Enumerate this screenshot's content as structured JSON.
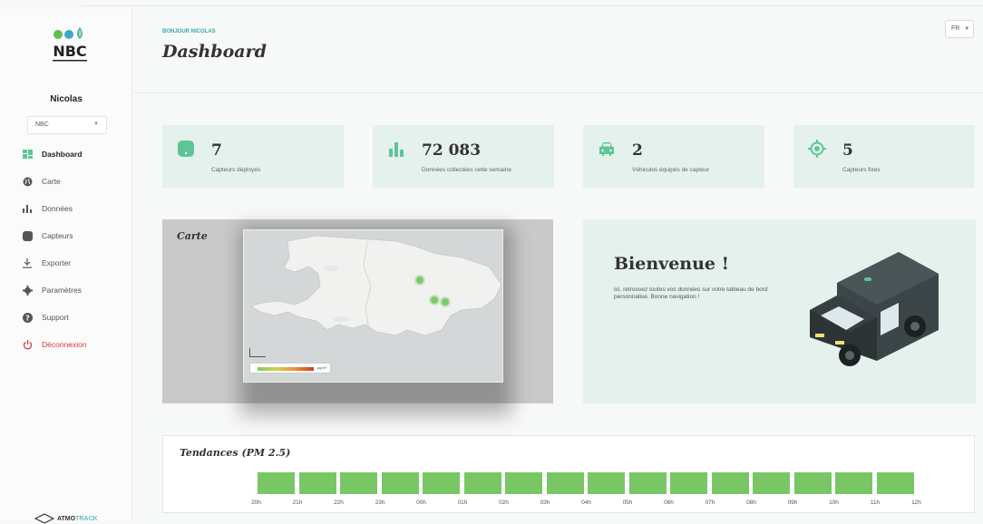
{
  "sidebar": {
    "user_name": "Nicolas",
    "org_select": "NBC",
    "logo_text": "NBC",
    "items": [
      {
        "label": "Dashboard",
        "icon": "dashboard-icon"
      },
      {
        "label": "Carte",
        "icon": "globe-icon"
      },
      {
        "label": "Données",
        "icon": "bar-chart-icon"
      },
      {
        "label": "Capteurs",
        "icon": "sensor-icon"
      },
      {
        "label": "Exporter",
        "icon": "download-icon"
      },
      {
        "label": "Paramètres",
        "icon": "gear-icon"
      },
      {
        "label": "Support",
        "icon": "question-icon"
      },
      {
        "label": "Déconnexion",
        "icon": "power-icon"
      }
    ],
    "brand_prefix": "ATMO",
    "brand_suffix": "TRACK"
  },
  "header": {
    "greeting": "BONJOUR NICOLAS",
    "title": "Dashboard",
    "language": "FR"
  },
  "stats": [
    {
      "value": "7",
      "label": "Capteurs déployés",
      "icon": "sensor-icon"
    },
    {
      "value": "72 083",
      "label": "Données collectées cette semaine",
      "icon": "bar-chart-icon"
    },
    {
      "value": "2",
      "label": "Véhicules équipés de capteur",
      "icon": "car-icon"
    },
    {
      "value": "5",
      "label": "Capteurs fixes",
      "icon": "target-icon"
    }
  ],
  "map": {
    "title": "Carte",
    "legend_unit": "µg/m³"
  },
  "welcome": {
    "title": "Bienvenue !",
    "text": "Ici, retrouvez toutes vos données sur votre tableau de bord personnalisé. Bonne navigation !"
  },
  "trend": {
    "title": "Tendances (PM 2.5)",
    "hours": [
      "20h",
      "21h",
      "22h",
      "23h",
      "00h",
      "01h",
      "02h",
      "03h",
      "04h",
      "05h",
      "06h",
      "07h",
      "08h",
      "09h",
      "10h",
      "11h",
      "12h"
    ],
    "bar_color": "#79c665"
  },
  "colors": {
    "accent": "#5dc596",
    "card_bg": "#e4f1ec",
    "logout": "#d63a3a"
  }
}
